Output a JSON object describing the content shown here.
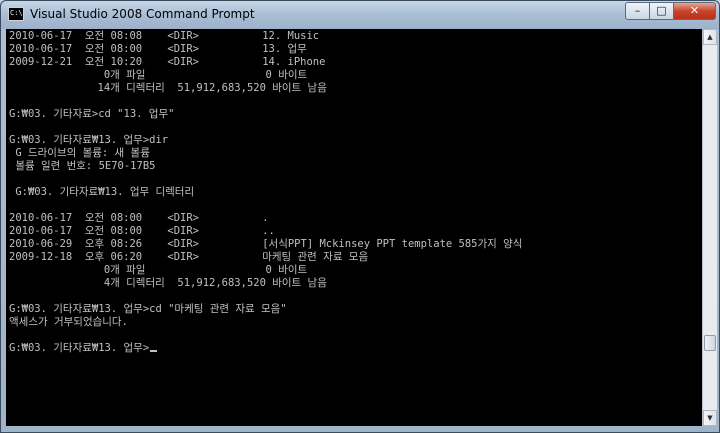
{
  "window": {
    "title": "Visual Studio 2008 Command Prompt",
    "icon_text": "C:\\",
    "minimize_glyph": "–",
    "maximize_glyph": "□",
    "close_glyph": "✕"
  },
  "scrollbar": {
    "up_glyph": "▲",
    "down_glyph": "▼",
    "position_fraction": 0.83
  },
  "console": {
    "lines": [
      "2010-06-17  오전 08:08    <DIR>          12. Music",
      "2010-06-17  오전 08:00    <DIR>          13. 업무",
      "2009-12-21  오전 10:20    <DIR>          14. iPhone",
      "               0개 파일                   0 바이트",
      "              14개 디렉터리  51,912,683,520 바이트 남음",
      "",
      "G:₩03. 기타자료>cd \"13. 업무\"",
      "",
      "G:₩03. 기타자료₩13. 업무>dir",
      " G 드라이브의 볼륨: 새 볼륨",
      " 볼륨 일련 번호: 5E70-17B5",
      "",
      " G:₩03. 기타자료₩13. 업무 디렉터리",
      "",
      "2010-06-17  오전 08:00    <DIR>          .",
      "2010-06-17  오전 08:00    <DIR>          ..",
      "2010-06-29  오후 08:26    <DIR>          [서식PPT] Mckinsey PPT template 585가지 양식",
      "2009-12-18  오후 06:20    <DIR>          마케팅 관련 자료 모음",
      "               0개 파일                   0 바이트",
      "               4개 디렉터리  51,912,683,520 바이트 남음",
      "",
      "G:₩03. 기타자료₩13. 업무>cd \"마케팅 관련 자료 모음\"",
      "액세스가 거부되었습니다.",
      "",
      "G:₩03. 기타자료₩13. 업무>"
    ]
  }
}
